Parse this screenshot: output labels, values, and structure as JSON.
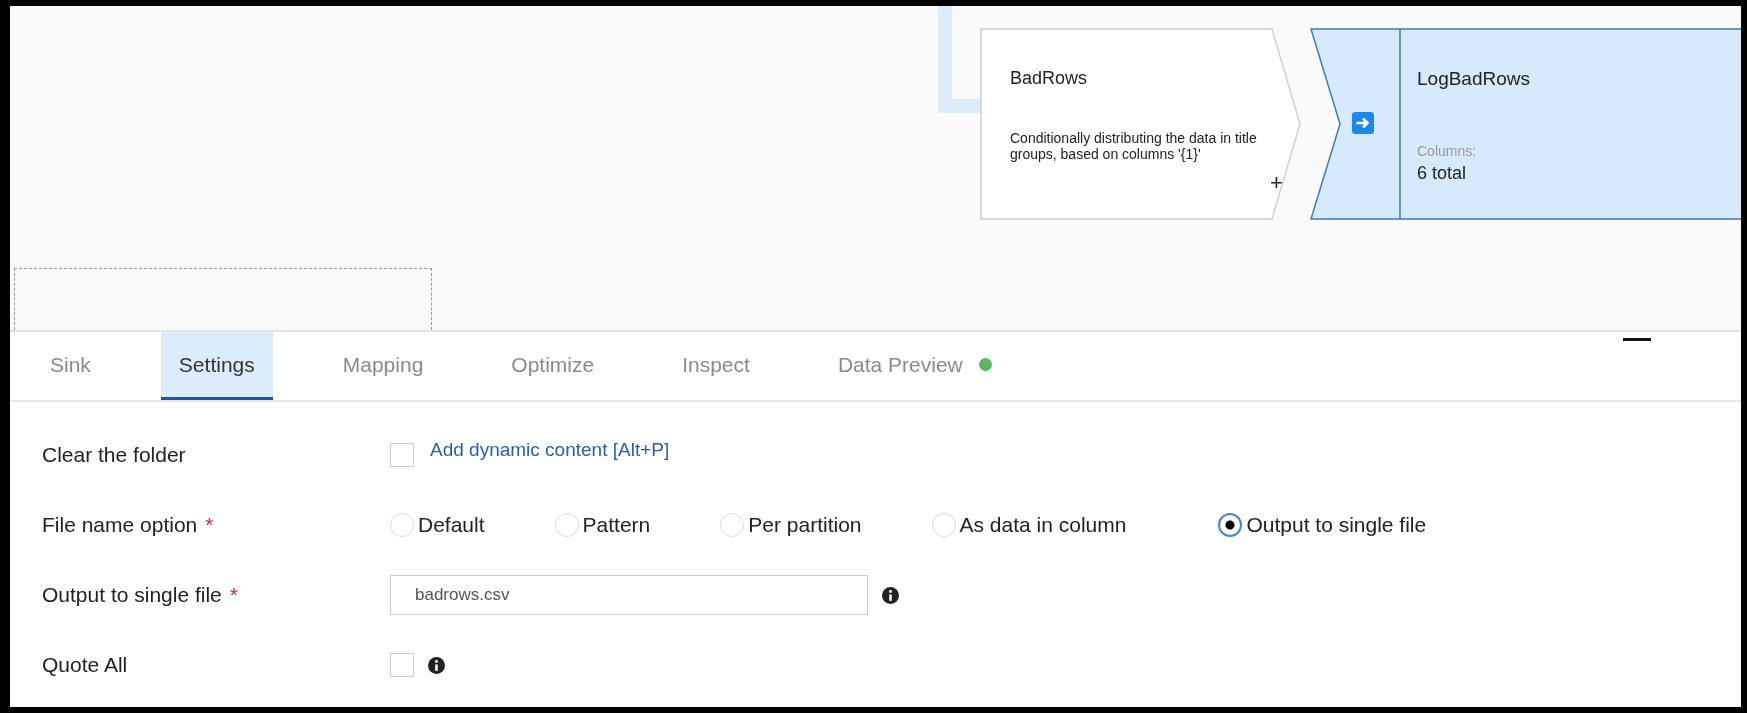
{
  "canvas": {
    "nodes": [
      {
        "kind": "transform",
        "title": "BadRows",
        "description": "Conditionally distributing the data in title groups, based on columns '{1}'",
        "add_symbol": "+"
      },
      {
        "kind": "sink",
        "title": "LogBadRows",
        "columns_label": "Columns:",
        "columns_value": "6 total",
        "selected": true
      }
    ]
  },
  "tabs": [
    {
      "label": "Sink",
      "selected": false
    },
    {
      "label": "Settings",
      "selected": true
    },
    {
      "label": "Mapping",
      "selected": false
    },
    {
      "label": "Optimize",
      "selected": false
    },
    {
      "label": "Inspect",
      "selected": false
    },
    {
      "label": "Data Preview",
      "selected": false,
      "color": "#5cb85c"
    }
  ],
  "settings": [
    {
      "kind": "checkbox",
      "label": "Clear the folder",
      "checked": false,
      "link": "Add dynamic content [Alt+P]"
    },
    {
      "kind": "radio",
      "label": "File name option",
      "required_mark": "*",
      "options": [
        {
          "label": "Default",
          "selected": false
        },
        {
          "label": "Pattern",
          "selected": false
        },
        {
          "label": "Per partition",
          "selected": false
        },
        {
          "label": "As data in column",
          "selected": false
        },
        {
          "label": "Output to single file",
          "selected": true
        }
      ]
    },
    {
      "kind": "text",
      "label": "Output to single file",
      "required_mark": "*",
      "value": "badrows.csv",
      "info": true
    },
    {
      "kind": "checkbox",
      "label": "Quote All",
      "checked": false,
      "info": true
    }
  ]
}
